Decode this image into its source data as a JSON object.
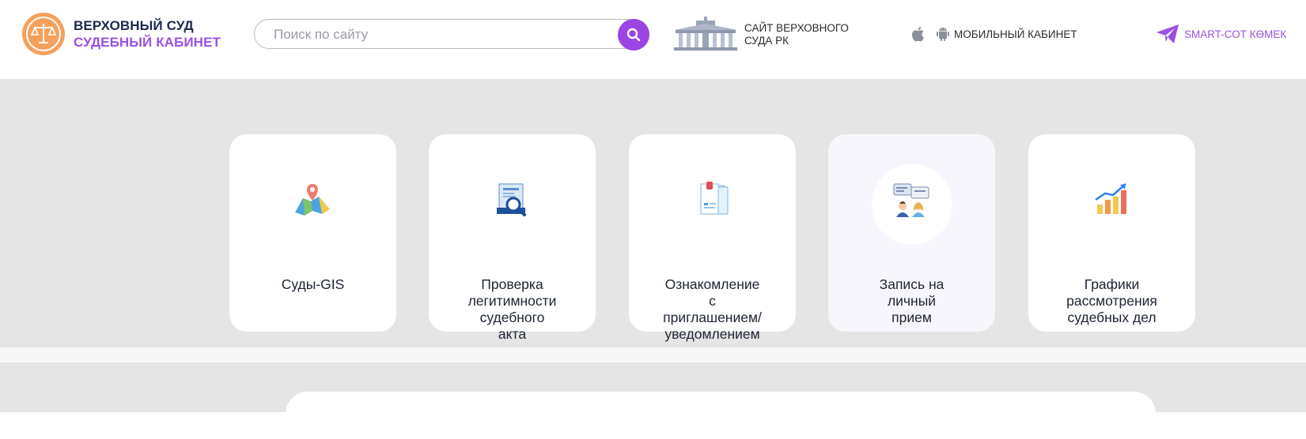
{
  "header": {
    "brand_line1": "ВЕРХОВНЫЙ СУД",
    "brand_line2": "СУДЕБНЫЙ КАБИНЕТ",
    "logo_icon": "scales-of-justice-icon",
    "search": {
      "placeholder": "Поиск по сайту",
      "value": "",
      "button_icon": "search-icon",
      "accent_color": "#9b45e4"
    },
    "court_site": {
      "icon": "court-building-icon",
      "label": "САЙТ ВЕРХОВНОГО\nСУДА РК"
    },
    "mobile_cabinet": {
      "icons": [
        "apple-icon",
        "android-icon"
      ],
      "label": "МОБИЛЬНЫЙ КАБИНЕТ"
    },
    "smart_help": {
      "icon": "paper-plane-icon",
      "label": "SMART-СОТ КӨМЕК"
    }
  },
  "services": [
    {
      "label": "Суды-GIS",
      "icon": "map-pin-icon"
    },
    {
      "label": "Проверка\nлегитимности\nсудебного\nакта",
      "icon": "document-magnifier-icon"
    },
    {
      "label": "Ознакомление\nс\nприглашением/\nуведомлением",
      "icon": "clipboard-documents-icon"
    },
    {
      "label": "Запись на\nличный\nприем",
      "icon": "consultation-people-icon",
      "active": true
    },
    {
      "label": "Графики\nрассмотрения\nсудебных дел",
      "icon": "growth-chart-icon"
    }
  ],
  "colors": {
    "brand_dark": "#1c2a52",
    "brand_purple": "#9b51e0",
    "logo_orange": "#f7a05c",
    "band_grey": "#e5e5e5"
  }
}
